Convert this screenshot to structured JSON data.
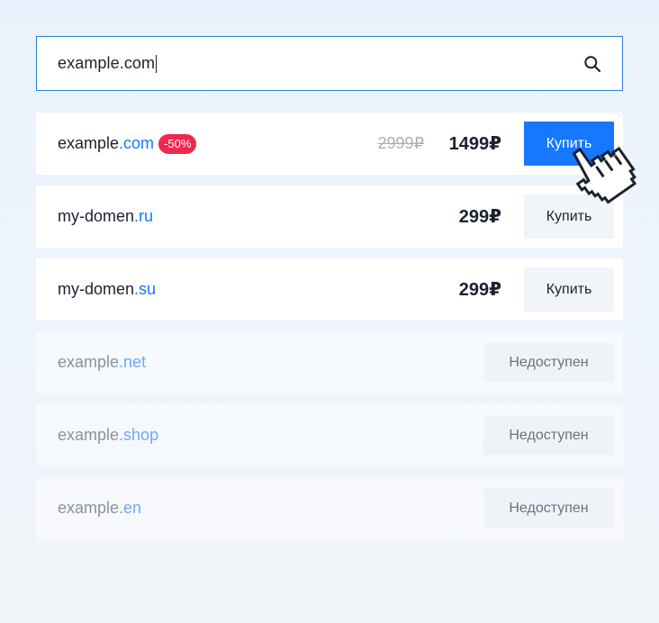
{
  "search": {
    "value": "example.com"
  },
  "results": [
    {
      "name": "example",
      "tld": ".com",
      "badge": "-50%",
      "old_price": "2999₽",
      "price": "1499₽",
      "action": "Купить",
      "status": "primary"
    },
    {
      "name": "my-domen",
      "tld": ".ru",
      "price": "299₽",
      "action": "Купить",
      "status": "available"
    },
    {
      "name": "my-domen",
      "tld": ".su",
      "price": "299₽",
      "action": "Купить",
      "status": "available"
    },
    {
      "name": "example",
      "tld": ".net",
      "action": "Недоступен",
      "status": "unavailable"
    },
    {
      "name": "example",
      "tld": ".shop",
      "action": "Недоступен",
      "status": "unavailable"
    },
    {
      "name": "example",
      "tld": ".en",
      "action": "Недоступен",
      "status": "unavailable"
    }
  ],
  "colors": {
    "accent": "#1677ff",
    "badge": "#f0274f",
    "text": "#1b2130",
    "muted": "#8a919e"
  }
}
